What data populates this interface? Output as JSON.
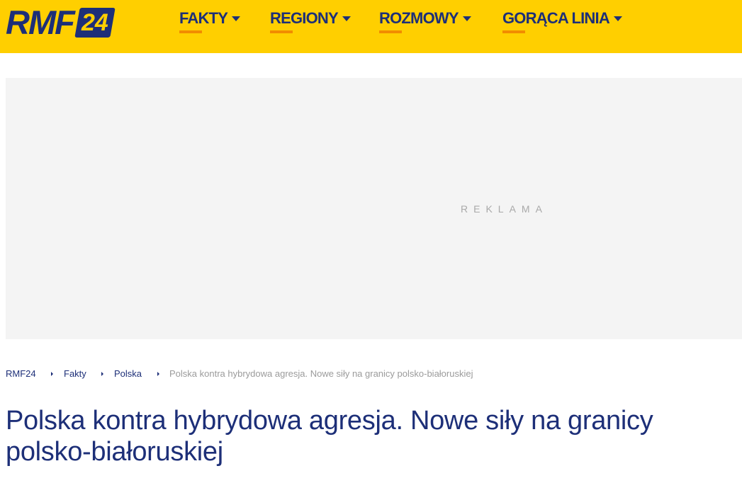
{
  "header": {
    "logo": {
      "text": "RMF",
      "badge": "24"
    },
    "nav": [
      {
        "label": "FAKTY"
      },
      {
        "label": "REGIONY"
      },
      {
        "label": "ROZMOWY"
      },
      {
        "label": "GORĄCA LINIA"
      }
    ]
  },
  "ad": {
    "label": "REKLAMA"
  },
  "breadcrumb": [
    {
      "label": "RMF24"
    },
    {
      "label": "Fakty"
    },
    {
      "label": "Polska"
    },
    {
      "label": "Polska kontra hybrydowa agresja. Nowe siły na granicy polsko-białoruskiej"
    }
  ],
  "article": {
    "title": "Polska kontra hybrydowa agresja. Nowe siły na granicy polsko-białoruskiej"
  },
  "colors": {
    "header_bg": "#ffcf00",
    "brand_navy": "#1d2f78",
    "nav_underline": "#f28c00",
    "ad_bg": "#f4f4f4"
  },
  "icons": [
    "caret-down-icon",
    "breadcrumb-separator-icon"
  ]
}
